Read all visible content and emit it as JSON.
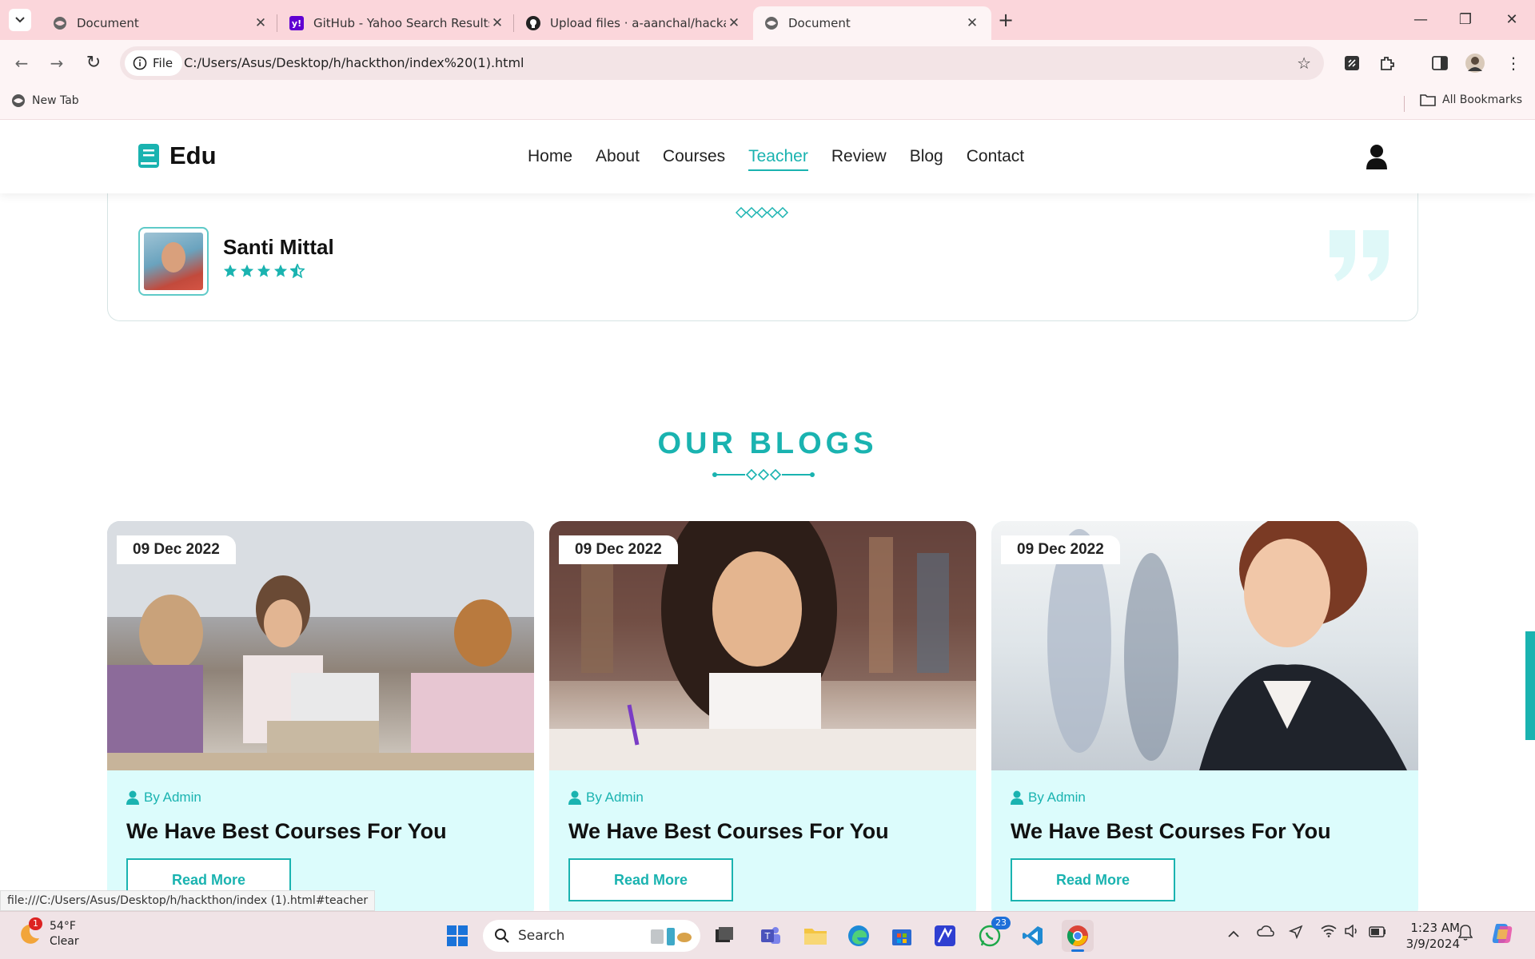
{
  "browser": {
    "tabs": [
      {
        "title": "Document",
        "active": false
      },
      {
        "title": "GitHub - Yahoo Search Results",
        "active": false
      },
      {
        "title": "Upload files · a-aanchal/hackathon",
        "active": false
      },
      {
        "title": "Document",
        "active": true
      }
    ],
    "address": {
      "chip": "File",
      "url": "C:/Users/Asus/Desktop/h/hackthon/index%20(1).html"
    },
    "bookmarks": {
      "left": "New Tab",
      "right": "All Bookmarks"
    },
    "status_url": "file:///C:/Users/Asus/Desktop/h/hackthon/index (1).html#teacher"
  },
  "site": {
    "logo": "Edu",
    "nav": [
      "Home",
      "About",
      "Courses",
      "Teacher",
      "Review",
      "Blog",
      "Contact"
    ],
    "active_nav": "Teacher",
    "accent": "#1ab3b0"
  },
  "review": {
    "name": "Santi Mittal",
    "rating": 4.5
  },
  "blogs": {
    "heading": "OUR BLOGS",
    "cards": [
      {
        "date": "09 Dec 2022",
        "author": "By Admin",
        "title": "We Have Best Courses For You",
        "button": "Read More"
      },
      {
        "date": "09 Dec 2022",
        "author": "By Admin",
        "title": "We Have Best Courses For You",
        "button": "Read More"
      },
      {
        "date": "09 Dec 2022",
        "author": "By Admin",
        "title": "We Have Best Courses For You",
        "button": "Read More"
      }
    ]
  },
  "taskbar": {
    "weather": {
      "temp": "54°F",
      "condition": "Clear",
      "alerts": "1"
    },
    "search": "Search",
    "whatsapp_badge": "23",
    "time": "1:23 AM",
    "date": "3/9/2024"
  }
}
